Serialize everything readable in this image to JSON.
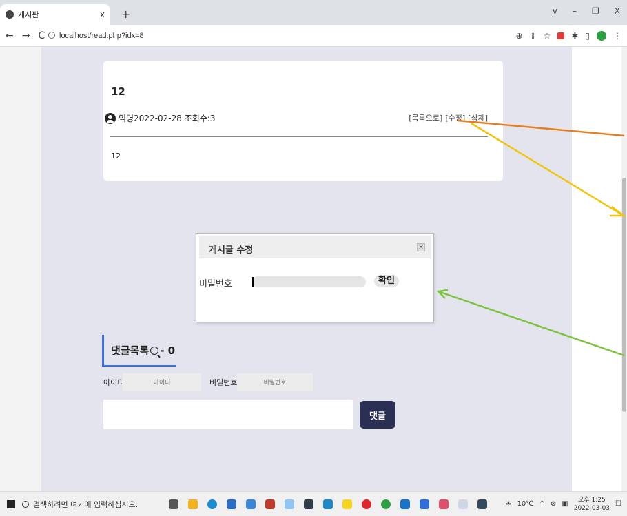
{
  "browser": {
    "tab_title": "게시판",
    "tab_close": "x",
    "new_tab": "+",
    "url": "localhost/read.php?idx=8",
    "window_controls": [
      "v",
      "–",
      "❐",
      "X"
    ]
  },
  "post": {
    "title": "12",
    "author": "익명",
    "date": "2022-02-28",
    "views_label": "조회수:3",
    "body": "12",
    "actions": {
      "list": "[목록으로]",
      "edit": "[수정]",
      "delete": "[삭제]"
    }
  },
  "modal": {
    "title": "게시글 수정",
    "close": "×",
    "password_label": "비밀번호",
    "confirm": "확인"
  },
  "comments": {
    "heading": "댓글목록",
    "count": "- 0",
    "id_label": "아이디",
    "id_placeholder": "아이디",
    "password_label": "비밀번호",
    "password_placeholder": "비밀번호",
    "submit": "댓글"
  },
  "taskbar": {
    "search_placeholder": "검색하려면 여기에 입력하십시오.",
    "temperature": "10℃",
    "time": "오후 1:25",
    "date": "2022-03-03"
  },
  "colors": {
    "content_bg": "#e4e4ee",
    "submit_bg": "#2b2f53",
    "accent_blue": "#3b6fe0",
    "arrow_orange": "#e67e22",
    "arrow_yellow": "#f1c40f",
    "arrow_green": "#7dc242"
  }
}
